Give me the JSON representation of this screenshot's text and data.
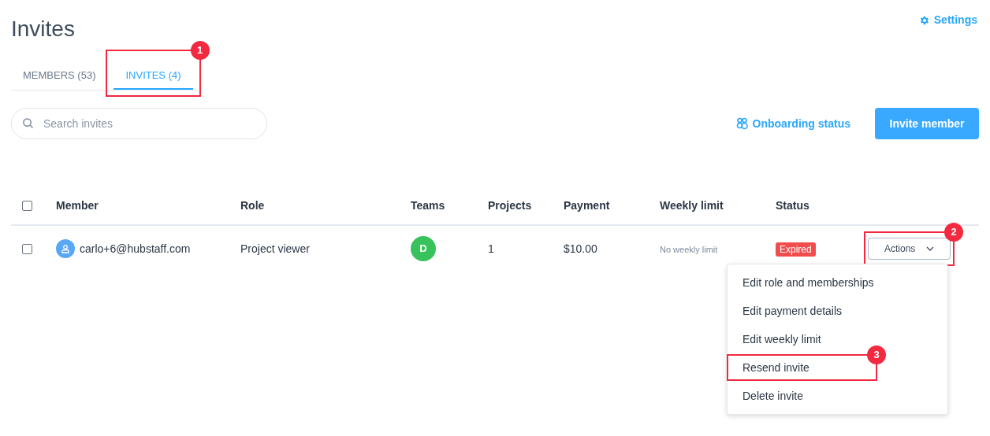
{
  "page": {
    "title": "Invites",
    "settings_link": "Settings"
  },
  "tabs": [
    {
      "label": "MEMBERS (53)",
      "selected": false
    },
    {
      "label": "INVITES (4)",
      "selected": true,
      "annotation": "1"
    }
  ],
  "search": {
    "placeholder": "Search invites"
  },
  "onboarding_link": "Onboarding status",
  "invite_button": "Invite member",
  "table": {
    "header_checked": false,
    "columns": [
      "Member",
      "Role",
      "Teams",
      "Projects",
      "Payment",
      "Weekly limit",
      "Status"
    ],
    "rows": [
      {
        "checked": false,
        "member": "carlo+6@hubstaff.com",
        "role": "Project viewer",
        "team_initial": "D",
        "projects": "1",
        "payment": "$10.00",
        "weekly_limit": "No weekly limit",
        "status": "Expired",
        "actions": "Actions",
        "actions_annotation": "2"
      }
    ]
  },
  "menu": {
    "items": [
      {
        "label": "Edit role and memberships"
      },
      {
        "label": "Edit payment details"
      },
      {
        "label": "Edit weekly limit"
      },
      {
        "label": "Resend invite",
        "annotation": "3"
      },
      {
        "label": "Delete invite"
      }
    ]
  }
}
